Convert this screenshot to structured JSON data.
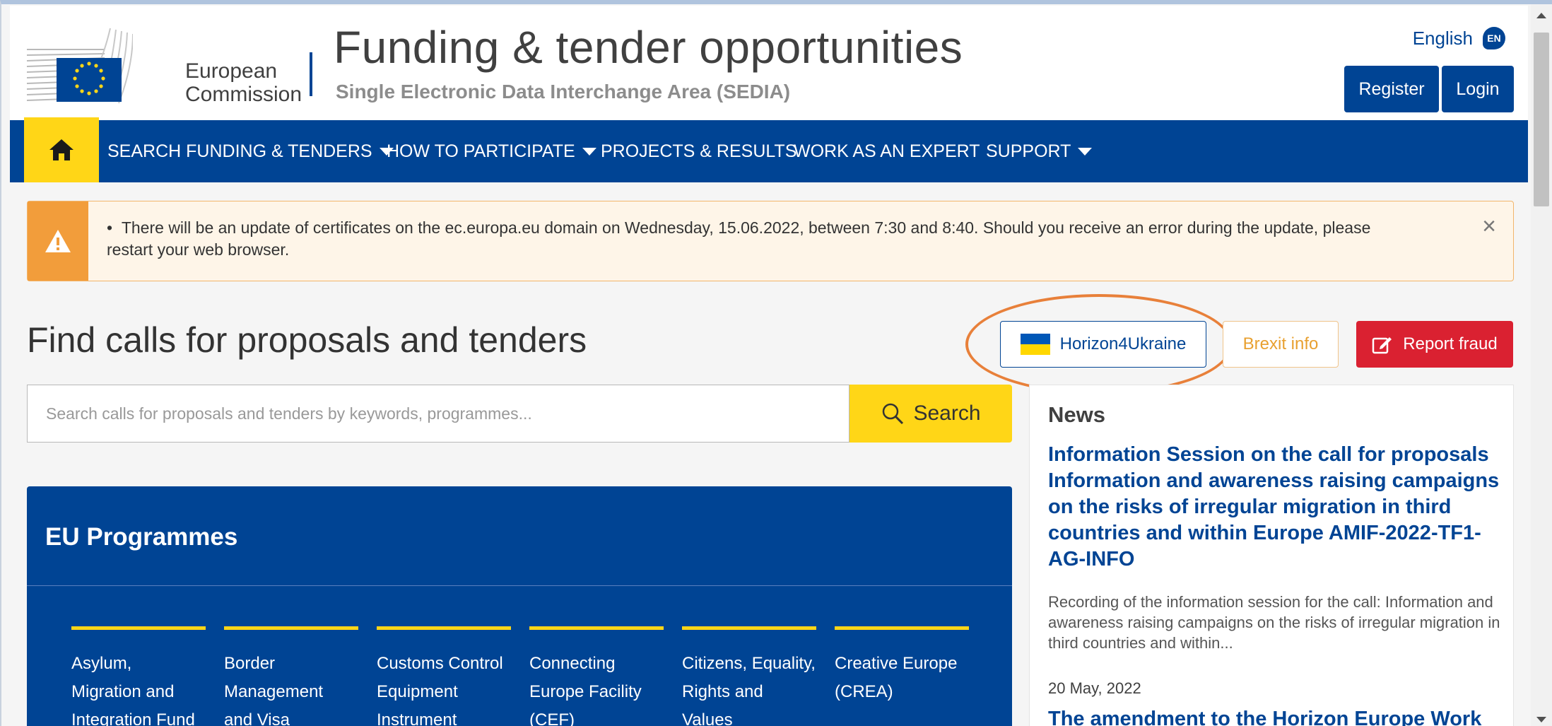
{
  "header": {
    "logo_text_line1": "European",
    "logo_text_line2": "Commission",
    "title": "Funding & tender opportunities",
    "subtitle": "Single Electronic Data Interchange Area (SEDIA)",
    "language": "English",
    "language_code": "EN",
    "register_label": "Register",
    "login_label": "Login"
  },
  "nav": {
    "items": [
      {
        "label": "SEARCH FUNDING & TENDERS",
        "has_dropdown": true
      },
      {
        "label": "HOW TO PARTICIPATE",
        "has_dropdown": true
      },
      {
        "label": "PROJECTS & RESULTS",
        "has_dropdown": false
      },
      {
        "label": "WORK AS AN EXPERT",
        "has_dropdown": false
      },
      {
        "label": "SUPPORT",
        "has_dropdown": true
      }
    ]
  },
  "alert": {
    "bullet": "•",
    "text_line1": "There will be an update of certificates on the ec.europa.eu domain on Wednesday, 15.06.2022, between 7:30 and 8:40. Should you receive an error during the update, please",
    "text_line2": "restart your web browser.",
    "close_icon": "×"
  },
  "main": {
    "page_title": "Find calls for proposals and tenders",
    "horizon_label": "Horizon4Ukraine",
    "brexit_label": "Brexit info",
    "report_label": "Report fraud",
    "search_placeholder": "Search calls for proposals and tenders by keywords, programmes...",
    "search_button": "Search"
  },
  "programmes": {
    "title": "EU Programmes",
    "items": [
      {
        "l1": "Asylum,",
        "l2": "Migration and",
        "l3": "Integration Fund"
      },
      {
        "l1": "Border",
        "l2": "Management",
        "l3": "and Visa"
      },
      {
        "l1": "Customs Control",
        "l2": "Equipment",
        "l3": "Instrument"
      },
      {
        "l1": "Connecting",
        "l2": "Europe Facility",
        "l3": "(CEF)"
      },
      {
        "l1": "Citizens, Equality,",
        "l2": "Rights and",
        "l3": "Values"
      },
      {
        "l1": "Creative Europe",
        "l2": "(CREA)",
        "l3": ""
      }
    ]
  },
  "news": {
    "title": "News",
    "item1_title": "Information Session on the call for proposals Information and awareness raising campaigns on the risks of irregular migration in third countries and within Europe AMIF-2022-TF1-AG-INFO",
    "item1_desc": "Recording of the information session for the call: Information and awareness raising campaigns on the risks of irregular migration in third countries and within...",
    "item2_date": "20 May, 2022",
    "item2_title": "The amendment to the Horizon Europe Work"
  },
  "colors": {
    "primary_blue": "#004494",
    "accent_yellow": "#ffd617",
    "alert_orange": "#f29d3b",
    "report_red": "#da2131",
    "brexit_orange": "#e8a030",
    "highlight_oval": "#e8803a"
  },
  "icons": {
    "home": "home-icon",
    "warning": "warning-icon",
    "search": "search-icon",
    "edit": "edit-icon",
    "flag": "ukraine-flag-icon"
  }
}
